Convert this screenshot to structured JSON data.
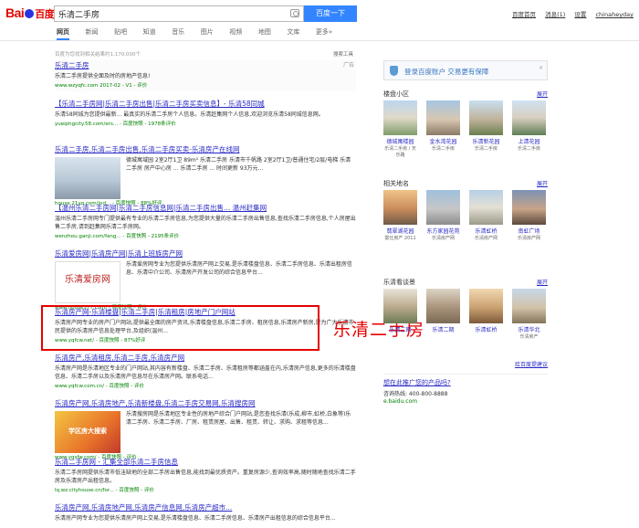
{
  "header": {
    "logo_bai": "Bai",
    "logo_du": "百度",
    "query": "乐清二手房",
    "search_button": "百度一下",
    "links": [
      "百度首页",
      "消息(1)",
      "设置",
      "chinaheyday"
    ]
  },
  "tabs": [
    "网页",
    "新闻",
    "贴吧",
    "知道",
    "音乐",
    "图片",
    "视频",
    "地图",
    "文库",
    "更多»"
  ],
  "result_count": "百度为您找到相关结果约1,170,000个",
  "search_tools": "搜索工具",
  "results": [
    {
      "title": "乐清二手房",
      "body": "乐清二手房提供全面及时的房地产信息!",
      "url": "www.wzyqfc.com 2017-02 - V1 - 评价",
      "ad": "广告"
    },
    {
      "title": "【乐清二手房网|乐清二手房出售|乐清二手房买卖信息】- 乐清58同城",
      "body": "乐清58同城为您提供最新... 最真实的乐清二手房个人信息。乐清赶集网个人信息,欢迎浏览乐清58同城信息网。",
      "url": "yueqingcity.58.com/ers... - 百度快照 - 1978条评价"
    },
    {
      "title": "乐清二手房,乐清二手房出售,乐清二手房买卖-乐清房产在线网",
      "body": "德城寓域园 2室2厅1卫 89m² 乐清二手房 乐清市千帆路 2室2厅1卫/普通住宅/2层/电梯 乐清二手房 房产中心房 ... 乐清二手房 ... 时间更新 93万元...",
      "url": "house.21yq.com/ind... - 百度快照 - 88%好评"
    },
    {
      "title": "【温州乐清二手房网|乐清二手房信息网|乐清二手房出售... 温州赶集网",
      "body": "温州乐清二手房网专门提供最有专业的乐清二手房信息,为您提供大量的乐清二手房出售信息,查找乐清二手房信息,个人房屋出售二手房,请到赶集网乐清二手房网。",
      "url": "wenzhou.ganji.com/fang... - 百度快照 - 2195条评价"
    },
    {
      "title": "乐清爱房网|乐清房产网|乐清上班族房产网",
      "body": "乐清爱房网专业为您提供乐清房产网上交易,是乐清楼盘信息、乐清二手房信息、乐清出租房信息、乐清中介公司、乐清房产开发公司的综合信息平台...",
      "url": "www.house577.com/ - 百度快照 - 评价"
    },
    {
      "title": "乐清房产网-乐清楼盘|乐清二手房|乐清租房|房地产门户网站",
      "body": "乐清房产网专业的房产门户网站,提供最全面的房产资讯,乐清楼盘信息,乐清二手房、租房信息,乐清房产新房,是为广大乐清市民提供的乐清房产信息处理平台,及组织(温州...",
      "url": "www.yqfcw.net/ - 百度快照 - 87%好评"
    },
    {
      "title": "乐清房产,乐清租房,乐清二手房,乐清房产网",
      "body": "乐清房产网是乐清地区专业的门户网站,其内容有新楼盘、乐清二手房、乐清租房等都涵盖在内,乐清房产信息,更多的乐清楼盘信息、乐清二手房以及乐清房产信息尽在乐清房产网。联系电话...",
      "url": "www.yqfcw.com.cn/ - 百度快照 - 评价"
    },
    {
      "title": "乐清房产网,乐清房地产,乐清新楼盘,乐清二手房交易网,乐清搜房网",
      "body": "乐清搜房网是乐清地区专业性的房地产综合门户网站,是您查找乐清(乐成,柳市,虹桥,白象等)乐清二手房、乐清二手房、厂房、租赁房屋、出售、租赁、转让、求购、求租等信息...",
      "url": "www.yqsfw.com/ - 百度快照 - 评价"
    },
    {
      "title": "乐清二手房网 - 汇集全部乐清二手房信息",
      "body": "乐清二手房网提供乐清市低洼缺地的全部二手房出售信息,能找到最优质资产。重复房源少,查询效率高,随时随地查找乐清二手房及乐清房产出租信息。",
      "url": "lq.wz.cityhouse.cn/for... - 百度快照 - 评价"
    },
    {
      "title": "乐清房产网,乐清房地产网,乐清房产信息网,乐清房产超市...",
      "body": "乐清房产网专业为您提供乐清房产网上交易,是乐清楼盘信息、乐清二手房信息、乐清房产出租信息的综合信息平台..."
    }
  ],
  "thumbs": {
    "r2": "house 21yq.com",
    "r4": "乐清爱房网",
    "r7": "学区房大搜索"
  },
  "annotation": "乐清二手房",
  "sidebar": {
    "login_text": "登录百度账户 交易更有保障",
    "close": "×",
    "sec1_title": "楼盘小区",
    "sec1_more": "展开",
    "sec1_items": [
      {
        "name": "德城寓楼园",
        "sub": "乐清二手房 / 天乐路"
      },
      {
        "name": "金水湾花园",
        "sub": "乐清二手房"
      },
      {
        "name": "乐清新花园",
        "sub": "乐清二手房"
      },
      {
        "name": "上清花园",
        "sub": "乐清二手房"
      }
    ],
    "sec2_title": "相关地名",
    "sec2_more": "展开",
    "sec2_items": [
      {
        "name": "翡翠湖花园",
        "sub": "富仕房产 2011"
      },
      {
        "name": "东方家园花苑",
        "sub": "乐清房产网"
      },
      {
        "name": "乐清虹桥",
        "sub": "乐清房产网"
      },
      {
        "name": "南虹广场",
        "sub": "乐清房产网"
      }
    ],
    "sec3_title": "乐清看谈景",
    "sec3_more": "展开",
    "sec3_items": [
      {
        "name": "乐清二期",
        "sub": ""
      },
      {
        "name": "乐清二期",
        "sub": ""
      },
      {
        "name": "乐清虹桥",
        "sub": ""
      },
      {
        "name": "乐清华北",
        "sub": "乐清房产"
      }
    ],
    "feedback": "给百度提建议",
    "promo": "想在此推广您的产品吗?",
    "tel": "咨询热线: 400-800-8888",
    "domain": "e.baidu.com"
  },
  "colors": {
    "link": "#2a2ac6",
    "highlight": "#cc0000",
    "url_green": "#008000",
    "button": "#3385ff",
    "annotation_red": "#e60000"
  }
}
